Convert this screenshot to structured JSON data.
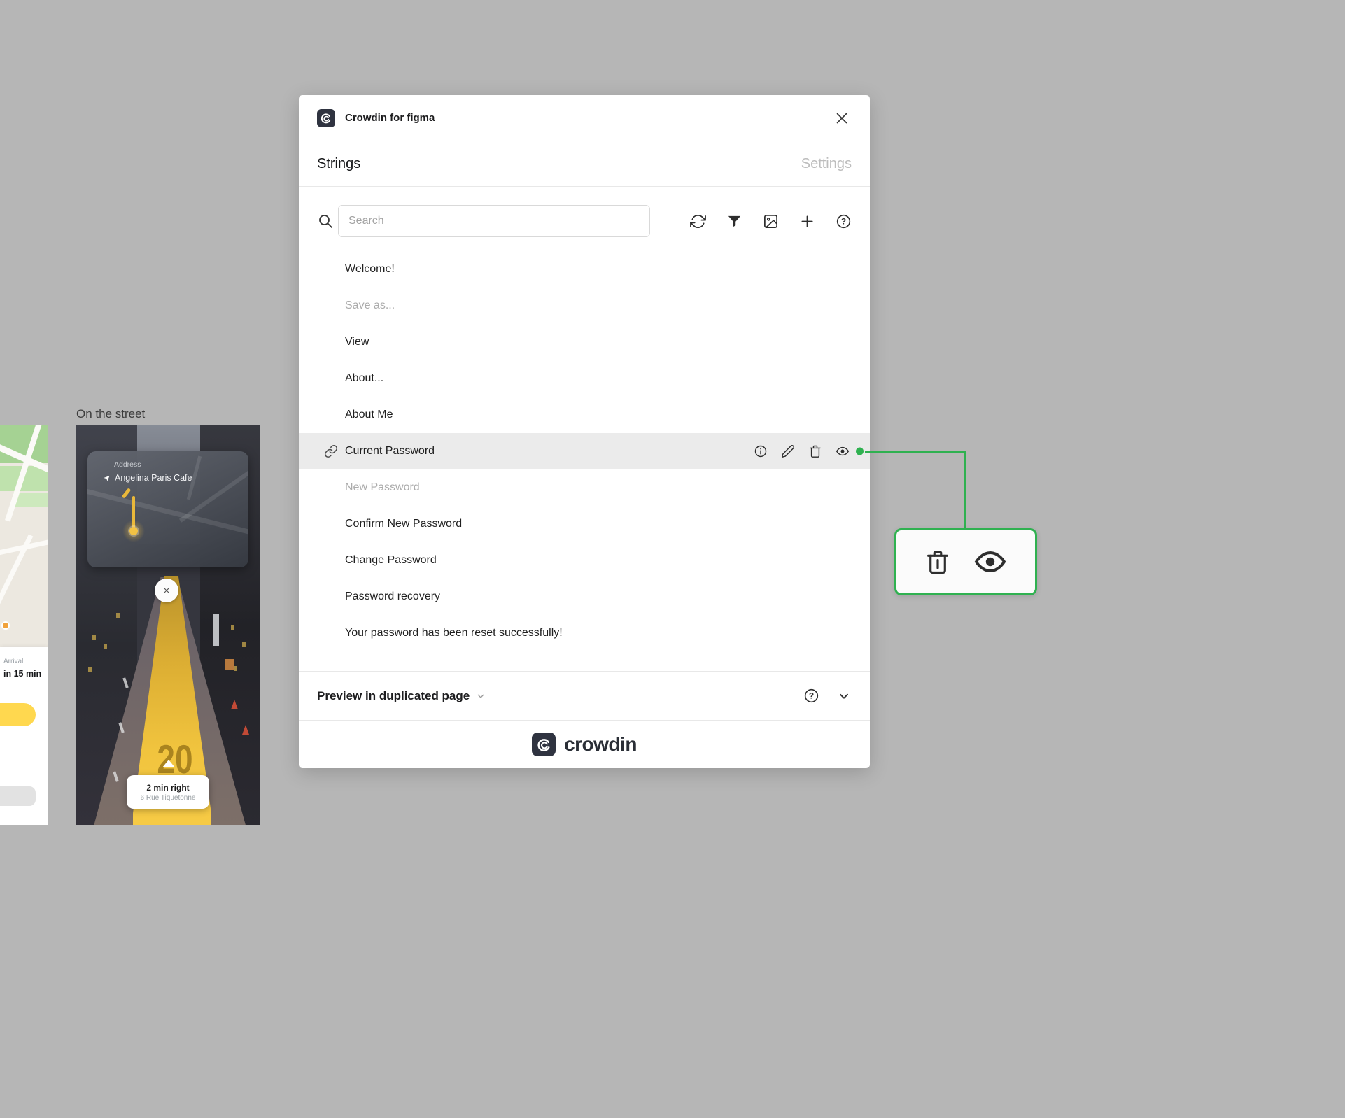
{
  "canvas": {
    "artboard_label": "On the street",
    "nav_phone": {
      "address_label": "Address",
      "address_value": "Angelina Paris Cafe",
      "path_number": "20",
      "direction_title": "2 min right",
      "direction_subtitle": "6 Rue Tiquetonne"
    },
    "map_phone": {
      "arrival_label": "Arrival",
      "arrival_value": "in 15 min"
    }
  },
  "modal": {
    "header": {
      "title": "Crowdin for figma"
    },
    "tabs": {
      "strings": "Strings",
      "settings": "Settings"
    },
    "toolbar": {
      "search_placeholder": "Search"
    },
    "strings": [
      {
        "label": "Welcome!"
      },
      {
        "label": "Save as...",
        "muted": true
      },
      {
        "label": "View"
      },
      {
        "label": "About..."
      },
      {
        "label": "About Me"
      },
      {
        "label": "Current Password",
        "selected": true
      },
      {
        "label": "New Password",
        "muted": true
      },
      {
        "label": "Confirm New Password"
      },
      {
        "label": "Change Password"
      },
      {
        "label": "Password recovery"
      },
      {
        "label": "Your password has been reset successfully!"
      }
    ],
    "footer": {
      "preview_label": "Preview in duplicated page"
    },
    "brand_wordmark": "crowdin"
  },
  "colors": {
    "accent_green": "#2fb150",
    "selected_row_bg": "#ebebeb",
    "path_yellow": "#f1c43e",
    "canvas_bg": "#b6b6b6"
  }
}
